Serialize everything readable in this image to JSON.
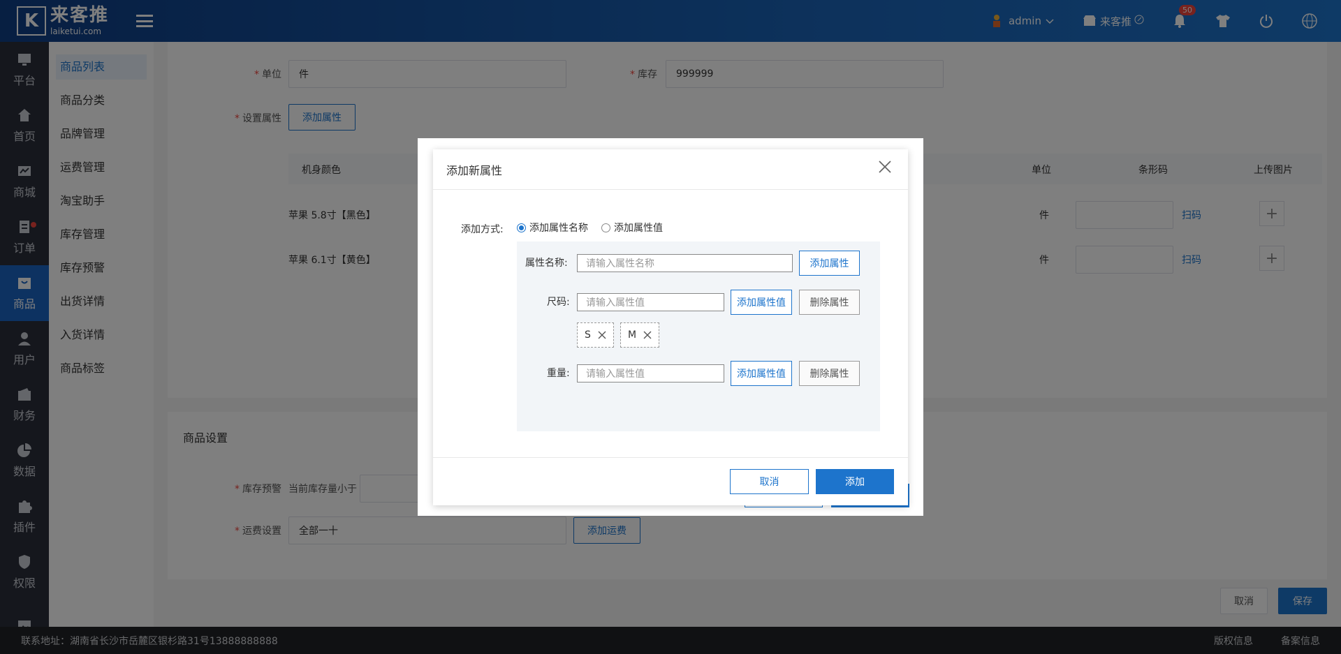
{
  "header": {
    "logo_mark": "K",
    "logo_title": "来客推",
    "logo_sub": "laiketui.com",
    "user": "admin",
    "store": "来客推",
    "notification_count": "50"
  },
  "sidebar": {
    "items": [
      {
        "label": "平台",
        "icon": "platform-icon"
      },
      {
        "label": "首页",
        "icon": "home-icon"
      },
      {
        "label": "商城",
        "icon": "store-icon"
      },
      {
        "label": "订单",
        "icon": "order-icon"
      },
      {
        "label": "商品",
        "icon": "goods-icon"
      },
      {
        "label": "用户",
        "icon": "user-icon"
      },
      {
        "label": "财务",
        "icon": "finance-icon"
      },
      {
        "label": "数据",
        "icon": "data-icon"
      },
      {
        "label": "插件",
        "icon": "plugin-icon"
      },
      {
        "label": "权限",
        "icon": "permission-icon"
      },
      {
        "label": "",
        "icon": "image-icon"
      }
    ]
  },
  "submenu": {
    "items": [
      "商品列表",
      "商品分类",
      "品牌管理",
      "运费管理",
      "淘宝助手",
      "库存管理",
      "库存预警",
      "出货详情",
      "入货详情",
      "商品标签"
    ]
  },
  "form": {
    "unit_label": "单位",
    "unit_value": "件",
    "stock_label": "库存",
    "stock_value": "999999",
    "set_attr_label": "设置属性",
    "add_attr_btn": "添加属性",
    "table_headers": [
      "机身颜色",
      "单位",
      "条形码",
      "上传图片"
    ],
    "rows": [
      {
        "name": "苹果 5.8寸【黑色】",
        "unit": "件",
        "scan": "扫码"
      },
      {
        "name": "苹果 6.1寸【黄色】",
        "unit": "件",
        "scan": "扫码"
      }
    ],
    "goods_settings_title": "商品设置",
    "stock_warning_label": "库存预警",
    "stock_warning_text": "当前库存量小于",
    "shipping_label": "运费设置",
    "shipping_value": "全部一十",
    "add_shipping_btn": "添加运费",
    "bottom_cancel": "取消",
    "bottom_save": "保存"
  },
  "footer": {
    "address": "联系地址：湖南省长沙市岳麓区银杉路31号13888888888",
    "copyright": "版权信息",
    "record": "备案信息"
  },
  "dialog": {
    "title": "添加新属性",
    "mode_label": "添加方式:",
    "mode_options": [
      "添加属性名称",
      "添加属性值"
    ],
    "attr_name_label": "属性名称:",
    "attr_name_placeholder": "请输入属性名称",
    "add_attr_btn": "添加属性",
    "attributes": [
      {
        "label": "尺码:",
        "placeholder": "请输入属性值",
        "add_value_btn": "添加属性值",
        "delete_btn": "删除属性",
        "values": [
          "S",
          "M"
        ]
      },
      {
        "label": "重量:",
        "placeholder": "请输入属性值",
        "add_value_btn": "添加属性值",
        "delete_btn": "删除属性",
        "values": []
      }
    ],
    "cancel_btn": "取消",
    "add_btn": "添加"
  }
}
